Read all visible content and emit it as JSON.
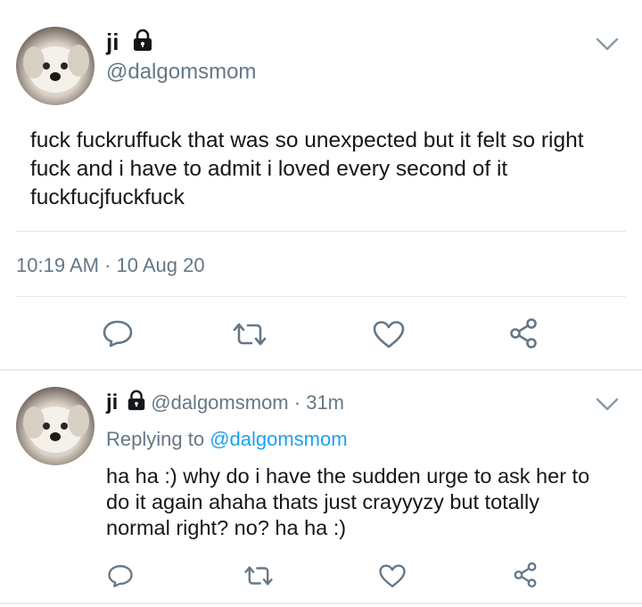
{
  "main_tweet": {
    "name": "ji",
    "handle": "@dalgomsmom",
    "text": "fuck fuckruffuck that was so unexpected but it felt so right fuck and i have to admit i loved every second of it fuckfucjfuckfuck",
    "timestamp": "10:19 AM · 10 Aug 20",
    "icons": [
      "lock-icon",
      "chevron-down-icon",
      "reply-icon",
      "retweet-icon",
      "like-icon",
      "share-icon"
    ]
  },
  "reply_tweet": {
    "name": "ji",
    "handle": "@dalgomsmom",
    "separator": " · ",
    "age": "31m",
    "replying_prefix": "Replying to ",
    "replying_handle": "@dalgomsmom",
    "text": "ha ha :) why do i have the sudden urge to ask her to do it again ahaha thats just crayyyzy but totally normal right? no? ha ha :)"
  },
  "colors": {
    "text": "#14171a",
    "secondary": "#657786",
    "link": "#1da1f2",
    "divider": "#e1e8ed"
  }
}
